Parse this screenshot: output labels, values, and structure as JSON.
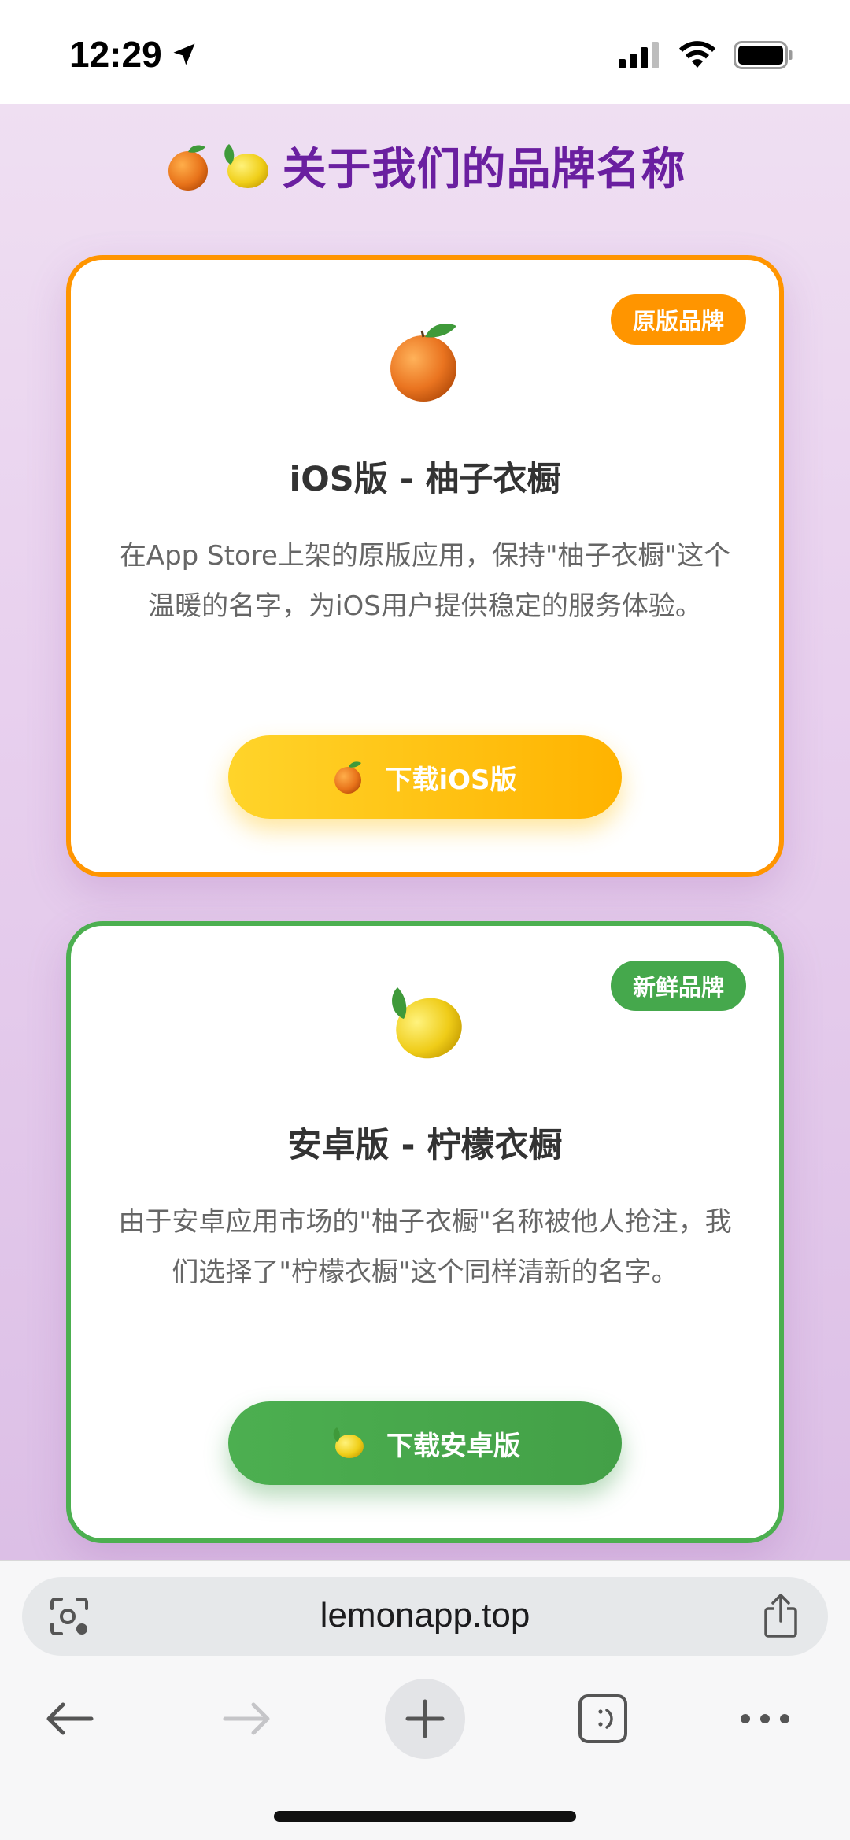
{
  "status_bar": {
    "time": "12:29"
  },
  "page": {
    "title": "关于我们的品牌名称"
  },
  "cards": [
    {
      "badge": "原版品牌",
      "title": "iOS版 - 柚子衣橱",
      "description": "在App Store上架的原版应用，保持\"柚子衣橱\"这个温暖的名字，为iOS用户提供稳定的服务体验。",
      "button_label": "下载iOS版",
      "accent_color": "#ff9500",
      "icon": "tangerine-icon"
    },
    {
      "badge": "新鲜品牌",
      "title": "安卓版 - 柠檬衣橱",
      "description": "由于安卓应用市场的\"柚子衣橱\"名称被他人抢注，我们选择了\"柠檬衣橱\"这个同样清新的名字。",
      "button_label": "下载安卓版",
      "accent_color": "#4caf50",
      "icon": "lemon-icon"
    }
  ],
  "browser": {
    "url": "lemonapp.top"
  },
  "colors": {
    "title_purple": "#6a1fa0",
    "page_background": "#e8d0ee"
  }
}
